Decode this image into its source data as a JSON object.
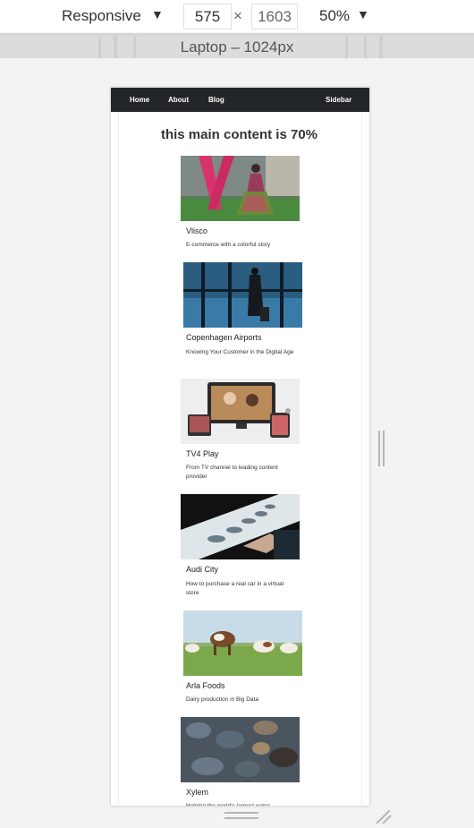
{
  "toolbar": {
    "device_mode": "Responsive",
    "width_value": "575",
    "height_value": "1603",
    "times": "×",
    "zoom": "50%"
  },
  "media_bar": {
    "label": "Laptop – 1024px"
  },
  "site": {
    "nav": [
      {
        "label": "Home"
      },
      {
        "label": "About"
      },
      {
        "label": "Blog"
      }
    ],
    "nav_right": "Sidebar",
    "main_title": "this main content is 70%",
    "cards": [
      {
        "title": "Vlisco",
        "desc": "E-commerce with a colorful story"
      },
      {
        "title": "Copenhagen Airports",
        "desc": "Knowing Your Customer in the Digital Age"
      },
      {
        "title": "TV4 Play",
        "desc": "From TV channel to leading content provider"
      },
      {
        "title": "Audi City",
        "desc": "How to purchase a real car in a virtual store"
      },
      {
        "title": "Arla Foods",
        "desc": "Dairy production in Big Data"
      },
      {
        "title": "Xylem",
        "desc": "Helping the world's largest water"
      }
    ]
  },
  "colors": {
    "nav_bg": "#232628",
    "toolbar_bg": "#ffffff",
    "ruler_bg": "#cfcfcf"
  }
}
